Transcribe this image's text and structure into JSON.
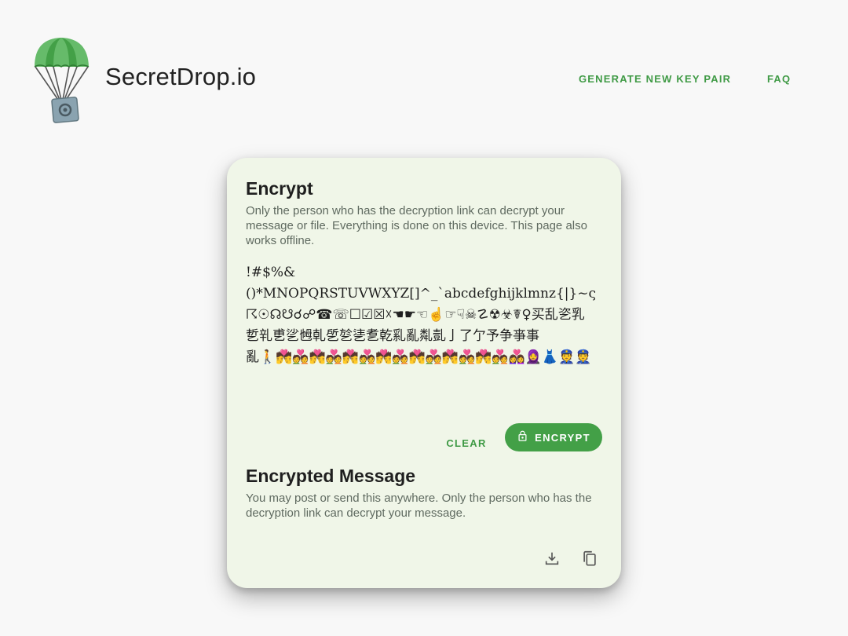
{
  "brand": {
    "name": "SecretDrop.io",
    "logo_icon": "parachute-safe-icon"
  },
  "nav": {
    "generate_label": "GENERATE NEW KEY PAIR",
    "faq_label": "FAQ"
  },
  "encrypt": {
    "title": "Encrypt",
    "description": "Only the person who has the decryption link can decrypt your message or file. Everything is done on this device. This page also works offline.",
    "message": "!#$%&\n()*MNOPQRSTUVWXYZ[]^_`abcdefghijklmnz{|}~ς\n☈☉☊☋☌☍☎☏☐☑☒☓☚☛☜☝☞☟☠☡☢☣☤♀买乱乲乳\n乴乵乶乷乸乹乺乻乼乽乾乿亂亃亄亅了亇予争亊事\n亂🚶💏💑💏💑💏💑💏💑💏💑💏💑💏💑👩‍❤️‍👩🧕👗👮👮👮",
    "clear_label": "CLEAR",
    "encrypt_label": "ENCRYPT",
    "encrypt_icon": "lock-icon"
  },
  "encrypted": {
    "title": "Encrypted Message",
    "description": "You may post or send this anywhere. Only the person who has the decryption link can decrypt your message.",
    "download_icon": "download-icon",
    "copy_icon": "copy-icon"
  },
  "colors": {
    "accent": "#43a047",
    "link": "#3f9a45",
    "card_bg": "#f0f6e8",
    "page_bg": "#f8f8f8"
  }
}
